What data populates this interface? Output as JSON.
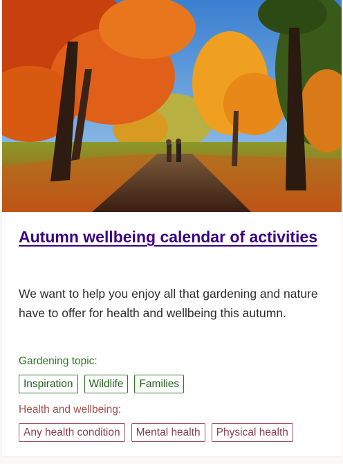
{
  "card": {
    "image_alt": "Two people walking along a path through a park with autumn trees",
    "title": "Autumn wellbeing calendar of activities",
    "description": "We want to help you enjoy all that gardening and nature have to offer for health and wellbeing this autumn."
  },
  "gardening": {
    "label": "Gardening topic:",
    "tags": [
      "Inspiration",
      "Wildlife",
      "Families"
    ]
  },
  "health": {
    "label": "Health and wellbeing:",
    "tags": [
      "Any health condition",
      "Mental health",
      "Physical health"
    ]
  },
  "colors": {
    "title": "#3b0083",
    "gardening_accent": "#2a7a1e",
    "health_accent": "#a0504a"
  }
}
